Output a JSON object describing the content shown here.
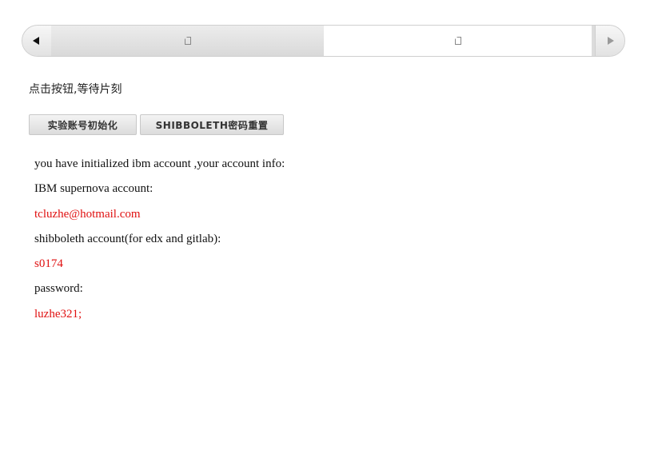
{
  "tabs": [
    {
      "icon": "page-icon"
    },
    {
      "icon": "page-icon"
    }
  ],
  "nav": {
    "prev_icon": "arrow-left-icon",
    "next_icon": "arrow-right-icon"
  },
  "instruction": "点击按钮,等待片刻",
  "buttons": {
    "init_label": "实验账号初始化",
    "reset_label": "SHIBBOLETH密码重置"
  },
  "info": {
    "intro": "you have initialized ibm account ,your account info:",
    "ibm_label": "IBM supernova account:",
    "ibm_value": "tcluzhe@hotmail.com",
    "shib_label": "shibboleth account(for edx and gitlab):",
    "shib_value": "s0174",
    "password_label": "password:",
    "password_value": "luzhe321;"
  },
  "colors": {
    "value_text": "#e01010",
    "body_text": "#111111"
  }
}
